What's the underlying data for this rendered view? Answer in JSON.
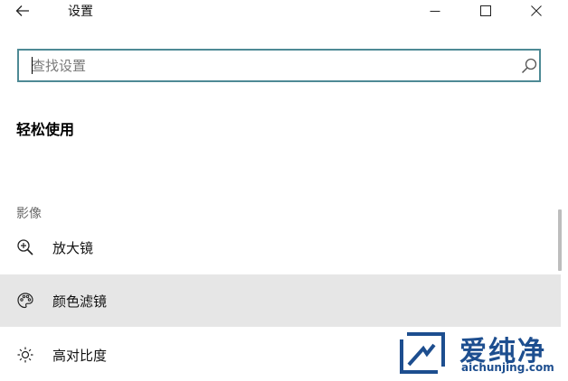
{
  "window": {
    "title": "设置",
    "back_icon": "back-arrow-icon",
    "controls": [
      "minimize-icon",
      "maximize-icon",
      "close-icon"
    ]
  },
  "search": {
    "placeholder": "查找设置",
    "value": "",
    "icon": "search-icon"
  },
  "page": {
    "section_title": "轻松使用",
    "group_header": "影像",
    "items": [
      {
        "label": "放大镜",
        "icon": "magnifier-zoom-icon",
        "selected": false
      },
      {
        "label": "颜色滤镜",
        "icon": "color-palette-icon",
        "selected": true
      },
      {
        "label": "高对比度",
        "icon": "brightness-sun-icon",
        "selected": false
      }
    ]
  },
  "watermark": {
    "text": "爱纯净",
    "url": "aichunjing.com"
  },
  "colors": {
    "search_border": "#4e8a95",
    "selected_bg": "#e6e6e6",
    "watermark": "#1d4e8f"
  }
}
